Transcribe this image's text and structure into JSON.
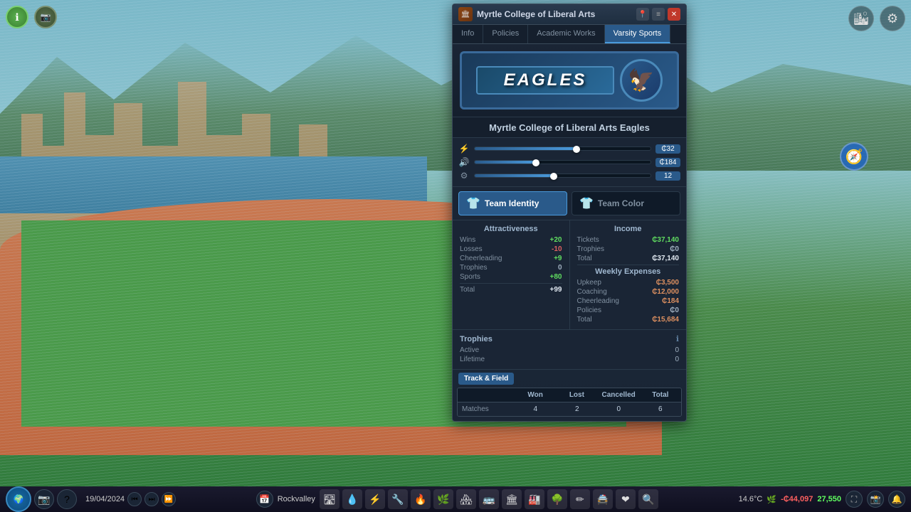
{
  "background": {
    "sky_color": "#7ab8c8"
  },
  "top_left_buttons": [
    {
      "id": "info-btn",
      "icon": "ℹ",
      "color": "#4a8a4a"
    },
    {
      "id": "cam-btn",
      "icon": "📷",
      "color": "#4a6a4a"
    }
  ],
  "top_right_buttons": [
    {
      "id": "city-btn",
      "icon": "🏙"
    },
    {
      "id": "settings-btn",
      "icon": "⚙"
    }
  ],
  "panel": {
    "title": "Myrtle College of Liberal Arts",
    "team_name": "Myrtle College of Liberal Arts Eagles",
    "tabs": [
      {
        "label": "Info",
        "active": false
      },
      {
        "label": "Policies",
        "active": false
      },
      {
        "label": "Academic Works",
        "active": false
      },
      {
        "label": "Varsity Sports",
        "active": true
      }
    ],
    "logo": {
      "text": "EAGLES",
      "mascot_icon": "🦅"
    },
    "sliders": [
      {
        "icon": "⚡",
        "position": 58,
        "value": "₵32"
      },
      {
        "icon": "🔊",
        "position": 35,
        "value": "₵184"
      },
      {
        "icon": "⚙",
        "position": 45,
        "value": "12"
      }
    ],
    "identity_tab": {
      "label": "Team Identity",
      "icon": "👕",
      "active": true
    },
    "color_tab": {
      "label": "Team Color",
      "icon": "👕",
      "active": false
    },
    "attractiveness": {
      "title": "Attractiveness",
      "items": [
        {
          "label": "Wins",
          "value": "+20",
          "type": "positive"
        },
        {
          "label": "Losses",
          "value": "-10",
          "type": "negative"
        },
        {
          "label": "Cheerleading",
          "value": "+9",
          "type": "positive"
        },
        {
          "label": "Trophies",
          "value": "0",
          "type": "zero"
        },
        {
          "label": "Sports",
          "value": "+80",
          "type": "positive"
        }
      ],
      "total_label": "Total",
      "total_value": "+99"
    },
    "income": {
      "title": "Income",
      "items": [
        {
          "label": "Tickets",
          "value": "₵37,140",
          "type": "positive"
        },
        {
          "label": "Trophies",
          "value": "₵0",
          "type": "zero"
        },
        {
          "label": "Total",
          "value": "₵37,140",
          "type": "total"
        }
      ]
    },
    "trophies": {
      "title": "Trophies",
      "items": [
        {
          "label": "Active",
          "value": "0"
        },
        {
          "label": "Lifetime",
          "value": "0"
        }
      ]
    },
    "weekly_expenses": {
      "title": "Weekly Expenses",
      "items": [
        {
          "label": "Upkeep",
          "value": "₵3,500",
          "type": "cost"
        },
        {
          "label": "Coaching",
          "value": "₵12,000",
          "type": "cost"
        },
        {
          "label": "Cheerleading",
          "value": "₵184",
          "type": "cost"
        },
        {
          "label": "Policies",
          "value": "₵0",
          "type": "zero"
        },
        {
          "label": "Total",
          "value": "₵15,684",
          "type": "cost"
        }
      ]
    },
    "sport_tag": "Track & Field",
    "match_stats": {
      "headers": [
        "",
        "Won",
        "Lost",
        "Cancelled",
        "Total"
      ],
      "rows": [
        {
          "label": "Matches",
          "won": "4",
          "lost": "2",
          "cancelled": "0",
          "total": "6"
        }
      ]
    }
  },
  "bottom_bar": {
    "date": "19/04/2024",
    "city_name": "Rockvalley",
    "temperature": "14.6°C",
    "money": "-₵44,097",
    "population": "27,550"
  }
}
